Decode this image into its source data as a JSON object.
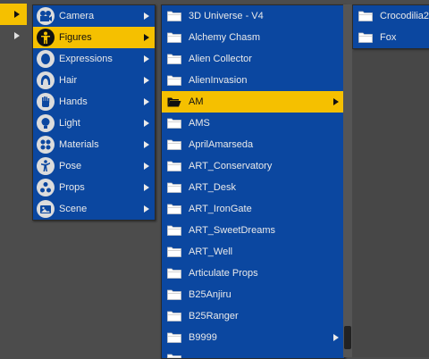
{
  "stub_rows": [
    {
      "selected": true
    },
    {
      "selected": false
    }
  ],
  "categories": [
    {
      "label": "Camera",
      "icon": "camera-icon",
      "selected": false
    },
    {
      "label": "Figures",
      "icon": "figure-icon",
      "selected": true
    },
    {
      "label": "Expressions",
      "icon": "expressions-icon",
      "selected": false
    },
    {
      "label": "Hair",
      "icon": "hair-icon",
      "selected": false
    },
    {
      "label": "Hands",
      "icon": "hands-icon",
      "selected": false
    },
    {
      "label": "Light",
      "icon": "light-icon",
      "selected": false
    },
    {
      "label": "Materials",
      "icon": "materials-icon",
      "selected": false
    },
    {
      "label": "Pose",
      "icon": "pose-icon",
      "selected": false
    },
    {
      "label": "Props",
      "icon": "props-icon",
      "selected": false
    },
    {
      "label": "Scene",
      "icon": "scene-icon",
      "selected": false
    }
  ],
  "figures": [
    {
      "label": "3D Universe - V4",
      "selected": false,
      "submenu": false
    },
    {
      "label": "Alchemy Chasm",
      "selected": false,
      "submenu": false
    },
    {
      "label": "Alien Collector",
      "selected": false,
      "submenu": false
    },
    {
      "label": "AlienInvasion",
      "selected": false,
      "submenu": false
    },
    {
      "label": "AM",
      "selected": true,
      "submenu": true
    },
    {
      "label": "AMS",
      "selected": false,
      "submenu": false
    },
    {
      "label": "AprilAmarseda",
      "selected": false,
      "submenu": false
    },
    {
      "label": "ART_Conservatory",
      "selected": false,
      "submenu": false
    },
    {
      "label": "ART_Desk",
      "selected": false,
      "submenu": false
    },
    {
      "label": "ART_IronGate",
      "selected": false,
      "submenu": false
    },
    {
      "label": "ART_SweetDreams",
      "selected": false,
      "submenu": false
    },
    {
      "label": "ART_Well",
      "selected": false,
      "submenu": false
    },
    {
      "label": "Articulate Props",
      "selected": false,
      "submenu": false
    },
    {
      "label": "B25Anjiru",
      "selected": false,
      "submenu": false
    },
    {
      "label": "B25Ranger",
      "selected": false,
      "submenu": false
    },
    {
      "label": "B9999",
      "selected": false,
      "submenu": true
    },
    {
      "label": "",
      "selected": false,
      "submenu": false
    }
  ],
  "am_items": [
    {
      "label": "Crocodilia2"
    },
    {
      "label": "Fox"
    }
  ],
  "colors": {
    "menu_bg": "#0b47a0",
    "highlight": "#f5c000",
    "background": "#4c4c4c"
  }
}
